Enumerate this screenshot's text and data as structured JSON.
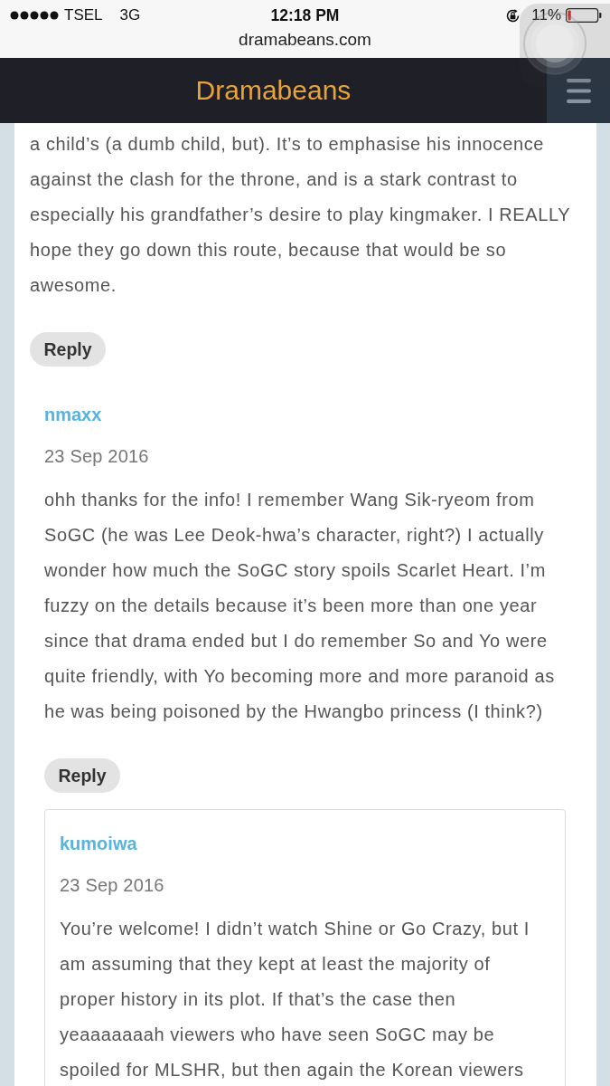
{
  "status_bar": {
    "carrier": "TSEL",
    "network": "3G",
    "time": "12:18 PM",
    "battery": "11%"
  },
  "browser": {
    "url": "dramabeans.com"
  },
  "site_header": {
    "title": "Dramabeans"
  },
  "comments": [
    {
      "body": "a child’s (a dumb child, but). It’s to emphasise his innocence against the clash for the throne, and is a stark contrast to especially his grandfather’s desire to play kingmaker. I REALLY hope they go down this route, because that would be so awesome.",
      "reply_button": "Reply",
      "children": [
        {
          "author": "nmaxx",
          "date": "23 Sep 2016",
          "body": "ohh thanks for the info! I remember Wang Sik-ryeom from SoGC (he was Lee Deok-hwa’s character, right?) I actually wonder how much the SoGC story spoils Scarlet Heart. I’m fuzzy on the details because it’s been more than one year since that drama ended but I do remember So and Yo were quite friendly, with Yo becoming more and more paranoid as he was being poisoned by the Hwangbo princess (I think?)",
          "reply_button": "Reply",
          "children": [
            {
              "author": "kumoiwa",
              "date": "23 Sep 2016",
              "body": "You’re welcome! I didn’t watch Shine or Go Crazy, but I am assuming that they kept at least the majority of proper history in its plot. If that’s the case then yeaaaaaaah viewers who have seen SoGC may be spoiled for MLSHR, but then again the Korean viewers"
            }
          ]
        }
      ]
    }
  ]
}
